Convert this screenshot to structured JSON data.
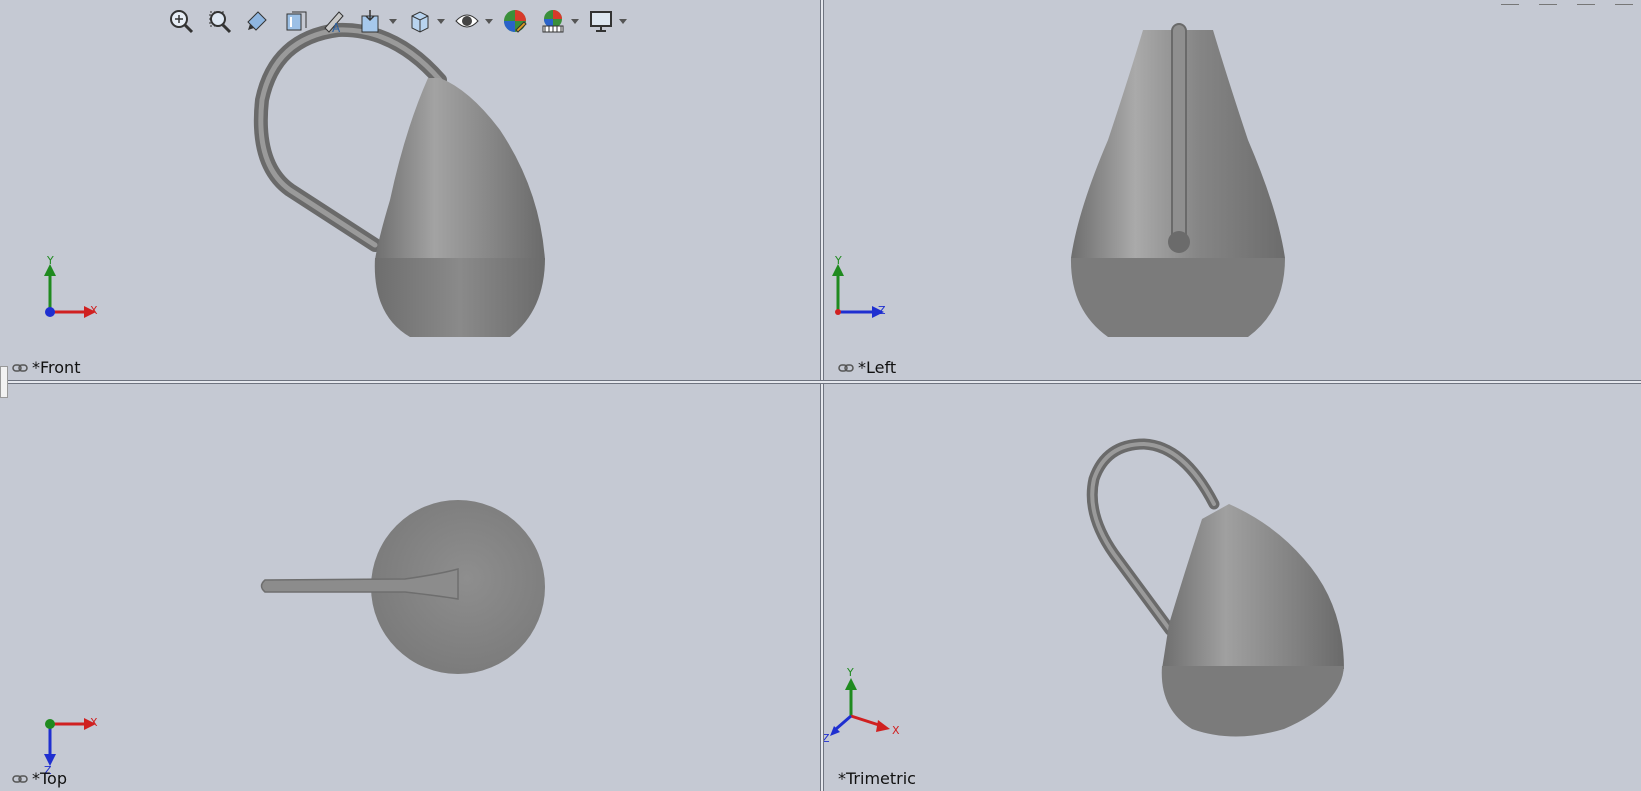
{
  "viewports": {
    "front": {
      "label": "*Front",
      "triad": {
        "up": "Y",
        "right": "X"
      }
    },
    "left": {
      "label": "*Left",
      "triad": {
        "up": "Y",
        "right": "Z"
      }
    },
    "top": {
      "label": "*Top",
      "triad": {
        "right": "X",
        "down": "Z"
      }
    },
    "trimetric": {
      "label": "*Trimetric",
      "triad": {
        "up": "Y",
        "right": "X",
        "left": "Z"
      }
    }
  },
  "toolbar": {
    "icons": [
      "zoom-to-fit-icon",
      "zoom-to-area-icon",
      "previous-view-icon",
      "section-view-icon",
      "dynamic-annotation-views-icon",
      "view-orientation-icon",
      "display-style-icon",
      "hide-show-items-icon",
      "edit-appearance-icon",
      "apply-scene-icon",
      "view-settings-icon"
    ]
  },
  "colors": {
    "background": "#c5c9d3",
    "model": "#8a8a8a",
    "axis_x": "#d02020",
    "axis_y": "#1f8a1f",
    "axis_z": "#1f2fd0"
  }
}
